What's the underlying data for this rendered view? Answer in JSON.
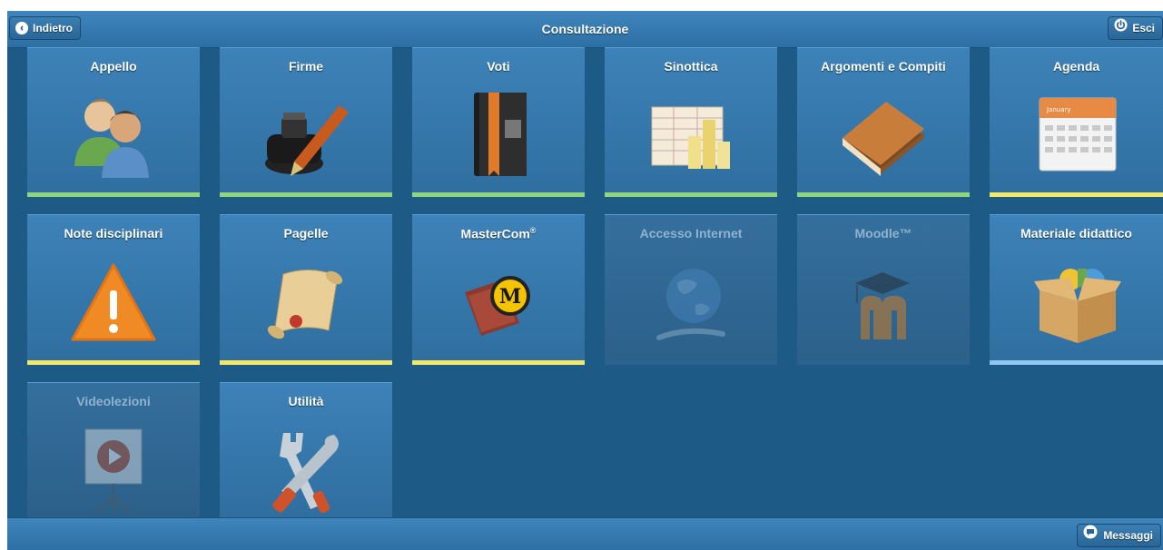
{
  "header": {
    "back_label": "Indietro",
    "title": "Consultazione",
    "exit_label": "Esci"
  },
  "tiles": [
    {
      "label": "Appello",
      "icon": "users-icon",
      "bar_color": "#8fd67c",
      "enabled": true
    },
    {
      "label": "Firme",
      "icon": "inkwell-pen-icon",
      "bar_color": "#8fd67c",
      "enabled": true
    },
    {
      "label": "Voti",
      "icon": "gradebook-icon",
      "bar_color": "#8fd67c",
      "enabled": true
    },
    {
      "label": "Sinottica",
      "icon": "spreadsheet-chart-icon",
      "bar_color": "#8fd67c",
      "enabled": true
    },
    {
      "label": "Argomenti e Compiti",
      "icon": "books-icon",
      "bar_color": "#8fd67c",
      "enabled": true
    },
    {
      "label": "Agenda",
      "icon": "calendar-icon",
      "bar_color": "#f3e86a",
      "enabled": true,
      "calendar_month": "January"
    },
    {
      "label": "Note disciplinari",
      "icon": "warning-icon",
      "bar_color": "#f3e86a",
      "enabled": true
    },
    {
      "label": "Pagelle",
      "icon": "scroll-icon",
      "bar_color": "#f3e86a",
      "enabled": true
    },
    {
      "label": "MasterCom",
      "label_sup": "®",
      "icon": "mastercom-icon",
      "bar_color": "#f3e86a",
      "enabled": true,
      "logo_letter": "M"
    },
    {
      "label": "Accesso Internet",
      "icon": "globe-icon",
      "bar_color": "#2b6290",
      "enabled": false
    },
    {
      "label": "Moodle™",
      "icon": "moodle-icon",
      "bar_color": "#2b6290",
      "enabled": false
    },
    {
      "label": "Materiale didattico",
      "icon": "box-icon",
      "bar_color": "#8ec8f2",
      "enabled": true
    },
    {
      "label": "Videolezioni",
      "icon": "projector-screen-icon",
      "bar_color": "",
      "enabled": false
    },
    {
      "label": "Utilità",
      "icon": "tools-icon",
      "bar_color": "",
      "enabled": true
    }
  ],
  "footer": {
    "messages_label": "Messaggi"
  }
}
